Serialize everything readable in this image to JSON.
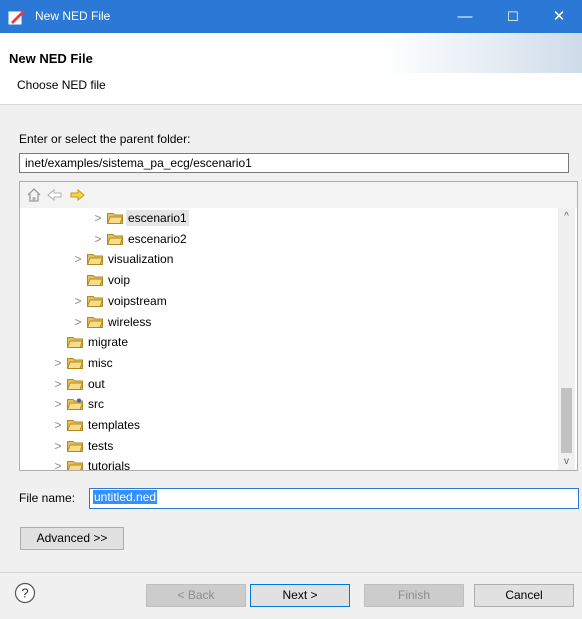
{
  "window": {
    "title": "New NED File",
    "minimize": "—",
    "maximize": "☐",
    "close": "✕"
  },
  "banner": {
    "heading": "New NED File",
    "description": "Choose NED file"
  },
  "parent": {
    "label": "Enter or select the parent folder:",
    "value": "inet/examples/sistema_pa_ecg/escenario1"
  },
  "tree": {
    "rows": [
      {
        "label": "escenario1",
        "twisty": true,
        "selected": true
      },
      {
        "label": "escenario2",
        "twisty": true
      },
      {
        "label": "visualization",
        "twisty": true
      },
      {
        "label": "voip",
        "twisty": false
      },
      {
        "label": "voipstream",
        "twisty": true
      },
      {
        "label": "wireless",
        "twisty": true
      },
      {
        "label": "migrate",
        "twisty": false
      },
      {
        "label": "misc",
        "twisty": true
      },
      {
        "label": "out",
        "twisty": true
      },
      {
        "label": "src",
        "twisty": true
      },
      {
        "label": "templates",
        "twisty": true
      },
      {
        "label": "tests",
        "twisty": true
      },
      {
        "label": "tutorials",
        "twisty": true
      }
    ]
  },
  "file": {
    "label": "File name:",
    "value": "untitled.ned"
  },
  "buttons": {
    "advanced": "Advanced >>",
    "back": "< Back",
    "next": "Next >",
    "finish": "Finish",
    "cancel": "Cancel"
  },
  "colors": {
    "accent": "#2b78d6",
    "folder": "#e8c060",
    "selection": "#3390ff"
  }
}
